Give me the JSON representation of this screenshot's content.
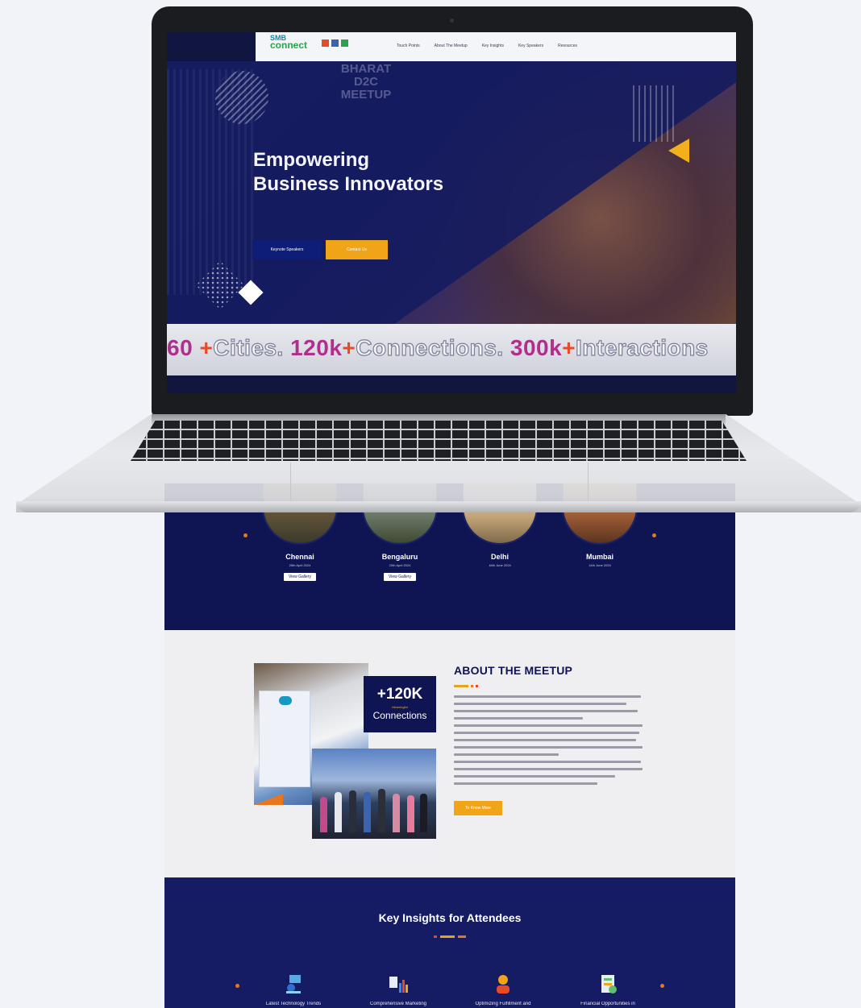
{
  "nav": {
    "logo_top": "SMB",
    "logo_bottom": "connect",
    "links": [
      "Touch Points",
      "About The Meetup",
      "Key Insights",
      "Key Speakers",
      "Resources"
    ]
  },
  "hero": {
    "faded_logo": [
      "BHARAT",
      "D2C",
      "MEETUP"
    ],
    "title_line1": "Empowering",
    "title_line2": "Business Innovators",
    "primary_button": "Keynote Speakers",
    "secondary_button": "Contact Us"
  },
  "ticker": {
    "n1": "60",
    "p1": "+",
    "w1": "Cities.",
    "n2": "120k",
    "p2": "+",
    "w2": "Connections.",
    "n3": "300k",
    "p3": "+",
    "w3": "Interactions"
  },
  "cities": [
    {
      "name": "Chennai",
      "date": "26th April 2024",
      "button": "View Gallery"
    },
    {
      "name": "Bengaluru",
      "date": "20th April 2024",
      "button": "View Gallery"
    },
    {
      "name": "Delhi",
      "date": "18th June 2024",
      "button": ""
    },
    {
      "name": "Mumbai",
      "date": "14th June 2024",
      "button": ""
    }
  ],
  "about": {
    "stat_big": "+120K",
    "stat_tiny": "Meaningful",
    "stat_sub": "Connections",
    "title": "ABOUT THE MEETUP",
    "button": "To Know More"
  },
  "insights": {
    "title": "Key Insights for Attendees",
    "items": [
      {
        "label": "Latest Technology Trends",
        "icon": "technology-icon"
      },
      {
        "label": "Comprehensive Marketing",
        "icon": "marketing-icon"
      },
      {
        "label": "Optimizing Fulfillment and",
        "icon": "fulfillment-icon"
      },
      {
        "label": "Financial Opportunities in",
        "icon": "finance-icon"
      }
    ]
  },
  "colors": {
    "navy": "#0f1552",
    "accent_orange": "#f0a418",
    "accent_magenta": "#b02f8c",
    "accent_red": "#e64a26"
  }
}
